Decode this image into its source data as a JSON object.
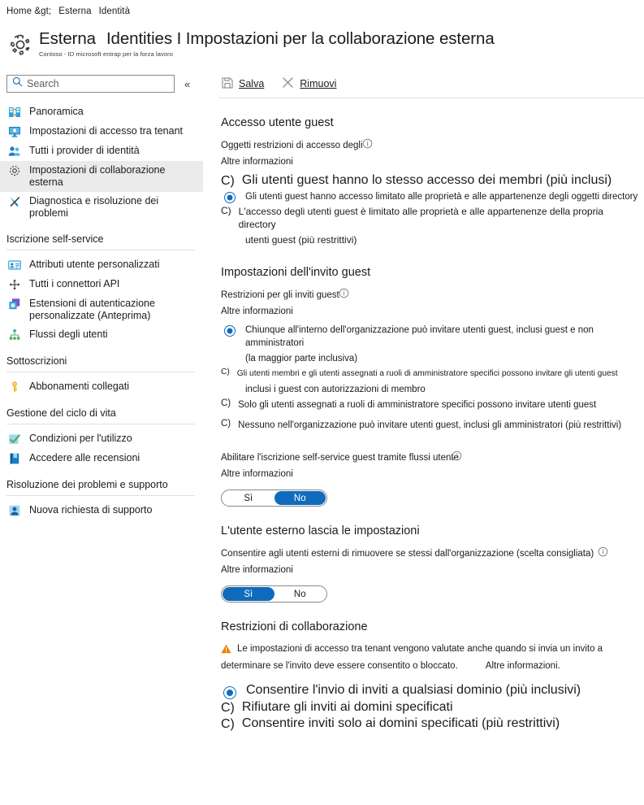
{
  "breadcrumb": {
    "home": "Home &gt;",
    "items": [
      "Esterna",
      "Identità"
    ]
  },
  "header": {
    "icon": "gear-icon",
    "title_prefix": "Esterna",
    "title_main": "Identities I Impostazioni per la collaborazione esterna",
    "subtitle": "Contoso - ID microsoft entrap per la forza lavoro"
  },
  "search": {
    "placeholder": "Search",
    "value": "",
    "icon": "search-icon",
    "collapse_icon": "«"
  },
  "sidebar": {
    "items": [
      {
        "label": "Panoramica",
        "icon": "overview-icon",
        "selected": false
      },
      {
        "label": "Impostazioni di accesso tra tenant",
        "icon": "monitor-icon",
        "selected": false
      },
      {
        "label": "Tutti i provider di identità",
        "icon": "users-icon",
        "selected": false
      },
      {
        "label": "Impostazioni di collaborazione esterna",
        "icon": "gear-icon",
        "selected": true
      },
      {
        "label": "Diagnostica e risoluzione dei problemi",
        "icon": "tools-icon",
        "selected": false
      }
    ],
    "sections": [
      {
        "title": "Iscrizione self-service",
        "items": [
          {
            "label": "Attributi utente personalizzati",
            "icon": "id-card-icon"
          },
          {
            "label": "Tutti i connettori API",
            "icon": "connector-icon"
          },
          {
            "label": "Estensioni di autenticazione personalizzate (Anteprima)",
            "icon": "extension-icon"
          },
          {
            "label": "Flussi degli utenti",
            "icon": "flow-icon"
          }
        ]
      },
      {
        "title": "Sottoscrizioni",
        "items": [
          {
            "label": "Abbonamenti collegati",
            "icon": "key-icon"
          }
        ]
      },
      {
        "title": "Gestione del ciclo di vita",
        "items": [
          {
            "label": "Condizioni per l'utilizzo",
            "icon": "checkmark-icon"
          },
          {
            "label": "Accedere alle recensioni",
            "icon": "book-icon"
          }
        ]
      },
      {
        "title": "Risoluzione dei problemi e supporto",
        "items": [
          {
            "label": "Nuova richiesta di supporto",
            "icon": "person-support-icon"
          }
        ]
      }
    ]
  },
  "toolbar": {
    "save_label": "Salva",
    "save_icon": "save-icon",
    "remove_label": "Rimuovi",
    "remove_icon": "close-icon"
  },
  "learn_more": "Altre informazioni",
  "learn_more_dot": "Altre informazioni.",
  "sections": {
    "guest_access": {
      "title": "Accesso utente guest",
      "field_label": "Oggetti restrizioni di accesso degli",
      "options": [
        {
          "text": "Gli utenti guest hanno lo stesso accesso dei membri (più inclusi)",
          "selected": false
        },
        {
          "text": "Gli utenti guest hanno accesso limitato alle proprietà e alle appartenenze degli oggetti directory",
          "selected": true
        },
        {
          "text": "L'accesso degli utenti guest è limitato alle proprietà e alle appartenenze della propria directory",
          "text2": "utenti guest (più restrittivi)",
          "selected": false
        }
      ]
    },
    "guest_invite": {
      "title": "Impostazioni dell'invito guest",
      "field_label": "Restrizioni per gli inviti guest",
      "options": [
        {
          "text": "Chiunque all'interno dell'organizzazione può invitare utenti guest, inclusi guest e non amministratori",
          "text2": "(la maggior parte inclusiva)",
          "selected": true
        },
        {
          "text": "Gli utenti membri e gli utenti assegnati a ruoli di amministratore specifici possono invitare gli utenti guest",
          "text2": "inclusi i guest con autorizzazioni di membro",
          "selected": false
        },
        {
          "text": "Solo gli utenti assegnati a ruoli di amministratore specifici possono invitare utenti guest",
          "selected": false
        },
        {
          "text": "Nessuno nell'organizzazione può invitare utenti guest, inclusi gli amministratori (più restrittivi)",
          "selected": false
        }
      ]
    },
    "self_service": {
      "field_label": "Abilitare l'iscrizione self-service guest tramite flussi utente",
      "toggle": {
        "yes": "Sì",
        "no": "No",
        "selected": "No"
      }
    },
    "external_leave": {
      "title": "L'utente esterno lascia le impostazioni",
      "field_label": "Consentire agli utenti esterni di rimuovere se stessi dall'organizzazione (scelta consigliata)",
      "toggle": {
        "yes": "Sì",
        "no": "No",
        "selected": "Sì"
      }
    },
    "collab_restrictions": {
      "title": "Restrizioni di collaborazione",
      "warning_icon": "warning-triangle-icon",
      "warning_line1": "Le impostazioni di accesso tra tenant vengono valutate anche quando si invia un invito a",
      "warning_line2": "determinare se l'invito deve essere consentito o bloccato.",
      "options": [
        {
          "text": "Consentire l'invio di inviti a qualsiasi dominio (più inclusivi)",
          "selected": true
        },
        {
          "text": "Rifiutare gli inviti ai domini specificati",
          "selected": false
        },
        {
          "text": "Consentire inviti solo ai domini specificati (più restrittivi)",
          "selected": false
        }
      ]
    }
  },
  "radio_off_glyph": "C)",
  "colors": {
    "accent": "#0f6cbd",
    "warning": "#e8820c",
    "selected_nav_bg": "#ebebeb"
  }
}
